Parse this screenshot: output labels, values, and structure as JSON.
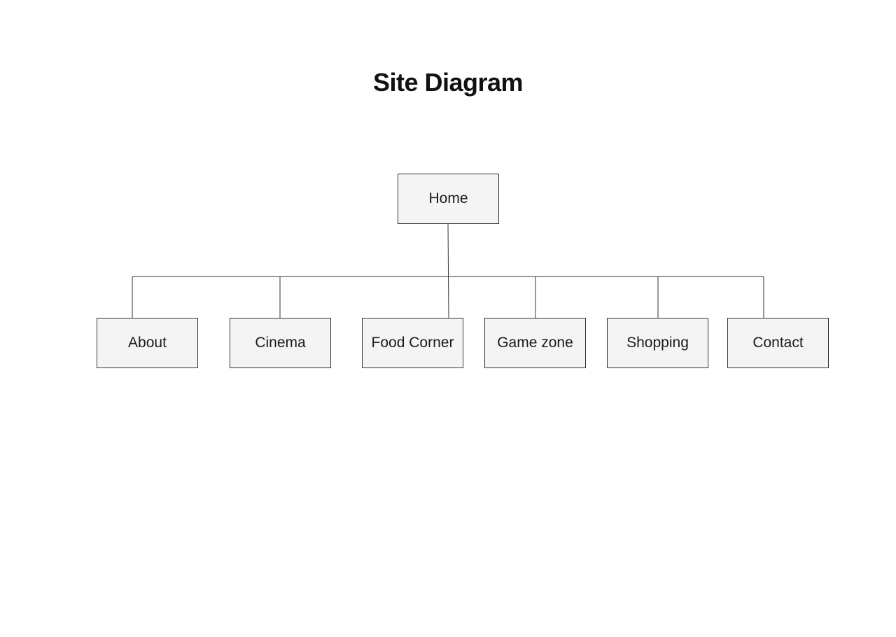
{
  "diagram": {
    "title": "Site Diagram",
    "root": {
      "label": "Home"
    },
    "children": [
      {
        "label": "About"
      },
      {
        "label": "Cinema"
      },
      {
        "label": "Food Corner"
      },
      {
        "label": "Game zone"
      },
      {
        "label": "Shopping"
      },
      {
        "label": "Contact"
      }
    ]
  }
}
